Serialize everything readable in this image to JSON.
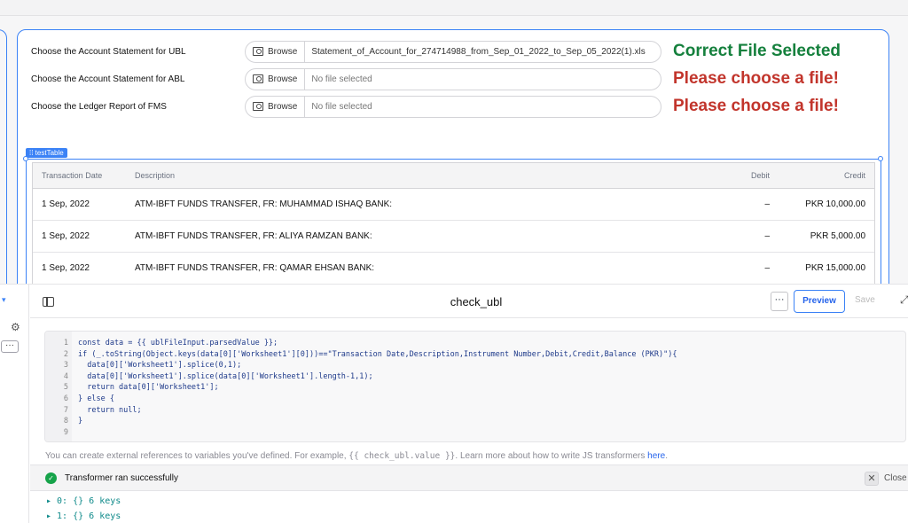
{
  "form": {
    "rows": [
      {
        "label": "Choose the Account Statement for UBL",
        "browse": "Browse",
        "file": "Statement_of_Account_for_274714988_from_Sep_01_2022_to_Sep_05_2022(1).xls",
        "status": "Correct File Selected"
      },
      {
        "label": "Choose the Account Statement for ABL",
        "browse": "Browse",
        "file": "No file selected",
        "status": "Please choose a file!"
      },
      {
        "label": "Choose the Ledger Report of FMS",
        "browse": "Browse",
        "file": "No file selected",
        "status": "Please choose a file!"
      }
    ]
  },
  "table": {
    "widget_name": "testTable",
    "columns": [
      "Transaction Date",
      "Description",
      "Debit",
      "Credit"
    ],
    "rows": [
      {
        "date": "1 Sep, 2022",
        "description": "ATM-IBFT FUNDS TRANSFER, FR: MUHAMMAD ISHAQ BANK:",
        "debit": "–",
        "credit": "PKR 10,000.00"
      },
      {
        "date": "1 Sep, 2022",
        "description": "ATM-IBFT FUNDS TRANSFER, FR: ALIYA RAMZAN BANK:",
        "debit": "–",
        "credit": "PKR 5,000.00"
      },
      {
        "date": "1 Sep, 2022",
        "description": "ATM-IBFT FUNDS TRANSFER, FR: QAMAR EHSAN BANK:",
        "debit": "–",
        "credit": "PKR 15,000.00"
      }
    ]
  },
  "panel": {
    "title": "check_ubl",
    "more": "···",
    "preview": "Preview",
    "save": "Save",
    "code_lines": [
      "const data = {{ ublFileInput.parsedValue }};",
      "if (_.toString(Object.keys(data[0]['Worksheet1'][0]))==\"Transaction Date,Description,Instrument Number,Debit,Credit,Balance (PKR)\"){",
      "  data[0]['Worksheet1'].splice(0,1);",
      "  data[0]['Worksheet1'].splice(data[0]['Worksheet1'].length-1,1);",
      "  return data[0]['Worksheet1'];",
      "} else {",
      "  return null;",
      "}",
      ""
    ],
    "help_prefix": "You can create external references to variables you've defined. For example,",
    "help_code": "{{ check_ubl.value }}",
    "help_suffix": ". Learn more about how to write JS transformers",
    "help_link": "here",
    "help_end": ".",
    "result_status": "Transformer ran successfully",
    "close_label": "Close",
    "outputs": [
      "▸ 0: {} 6 keys",
      "▸ 1: {} 6 keys"
    ]
  },
  "icons": {
    "browse": "file-search-icon",
    "check": "check-circle-icon",
    "close": "close-icon",
    "sidebar_toggle": "sidebar-toggle-icon",
    "expand": "expand-icon"
  },
  "colors": {
    "accent": "#3b82f6",
    "success": "#15803d",
    "error": "#c2352c"
  }
}
